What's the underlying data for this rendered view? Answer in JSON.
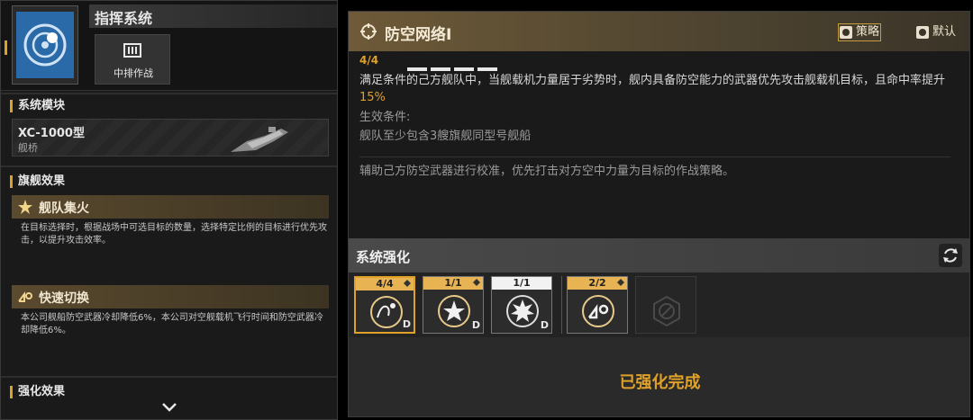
{
  "left_panel": {
    "title": "指挥系统",
    "tactic_label": "中排作战",
    "module_section_title": "系统模块",
    "module": {
      "name": "XC-1000型",
      "type": "舰桥"
    },
    "flagship_section_title": "旗舰效果",
    "effects": [
      {
        "name": "舰队集火",
        "description": "在目标选择时，根据战场中可选目标的数量，选择特定比例的目标进行优先攻击，以提升攻击效率。"
      },
      {
        "name": "快速切换",
        "description": "本公司舰船防空武器冷却降低6%，本公司对空舰载机飞行时间和防空武器冷却降低6%。"
      }
    ],
    "enhance_section_title": "强化效果"
  },
  "right_panel": {
    "title": "防空网络I",
    "strategy_label": "策略",
    "default_label": "默认",
    "level": "4/4",
    "level_bars": 4,
    "description_main": "满足条件的己方舰队中，当舰载机力量居于劣势时，舰内具备防空能力的武器优先攻击舰载机目标，且命中率提升",
    "description_highlight": "15%",
    "condition_label": "生效条件:",
    "condition_value": "舰队至少包含3艘旗舰同型号舰船",
    "flavor": "辅助己方防空武器进行校准，优先打击对方空中力量为目标的作战策略。",
    "enhance_title": "系统强化",
    "slots": [
      {
        "count": "4/4",
        "icon": "anti-air-icon",
        "active": true,
        "style": "gold"
      },
      {
        "count": "1/1",
        "icon": "focus-fire-icon",
        "active": false,
        "style": "gold"
      },
      {
        "count": "1/1",
        "icon": "burst-icon",
        "active": false,
        "style": "white"
      },
      {
        "count": "2/2",
        "icon": "quick-switch-icon",
        "active": false,
        "style": "gold"
      }
    ],
    "slot_d_mark": "D",
    "done_label": "已强化完成"
  },
  "colors": {
    "accent": "#e0a128",
    "header_brown": "#6e5a38"
  }
}
